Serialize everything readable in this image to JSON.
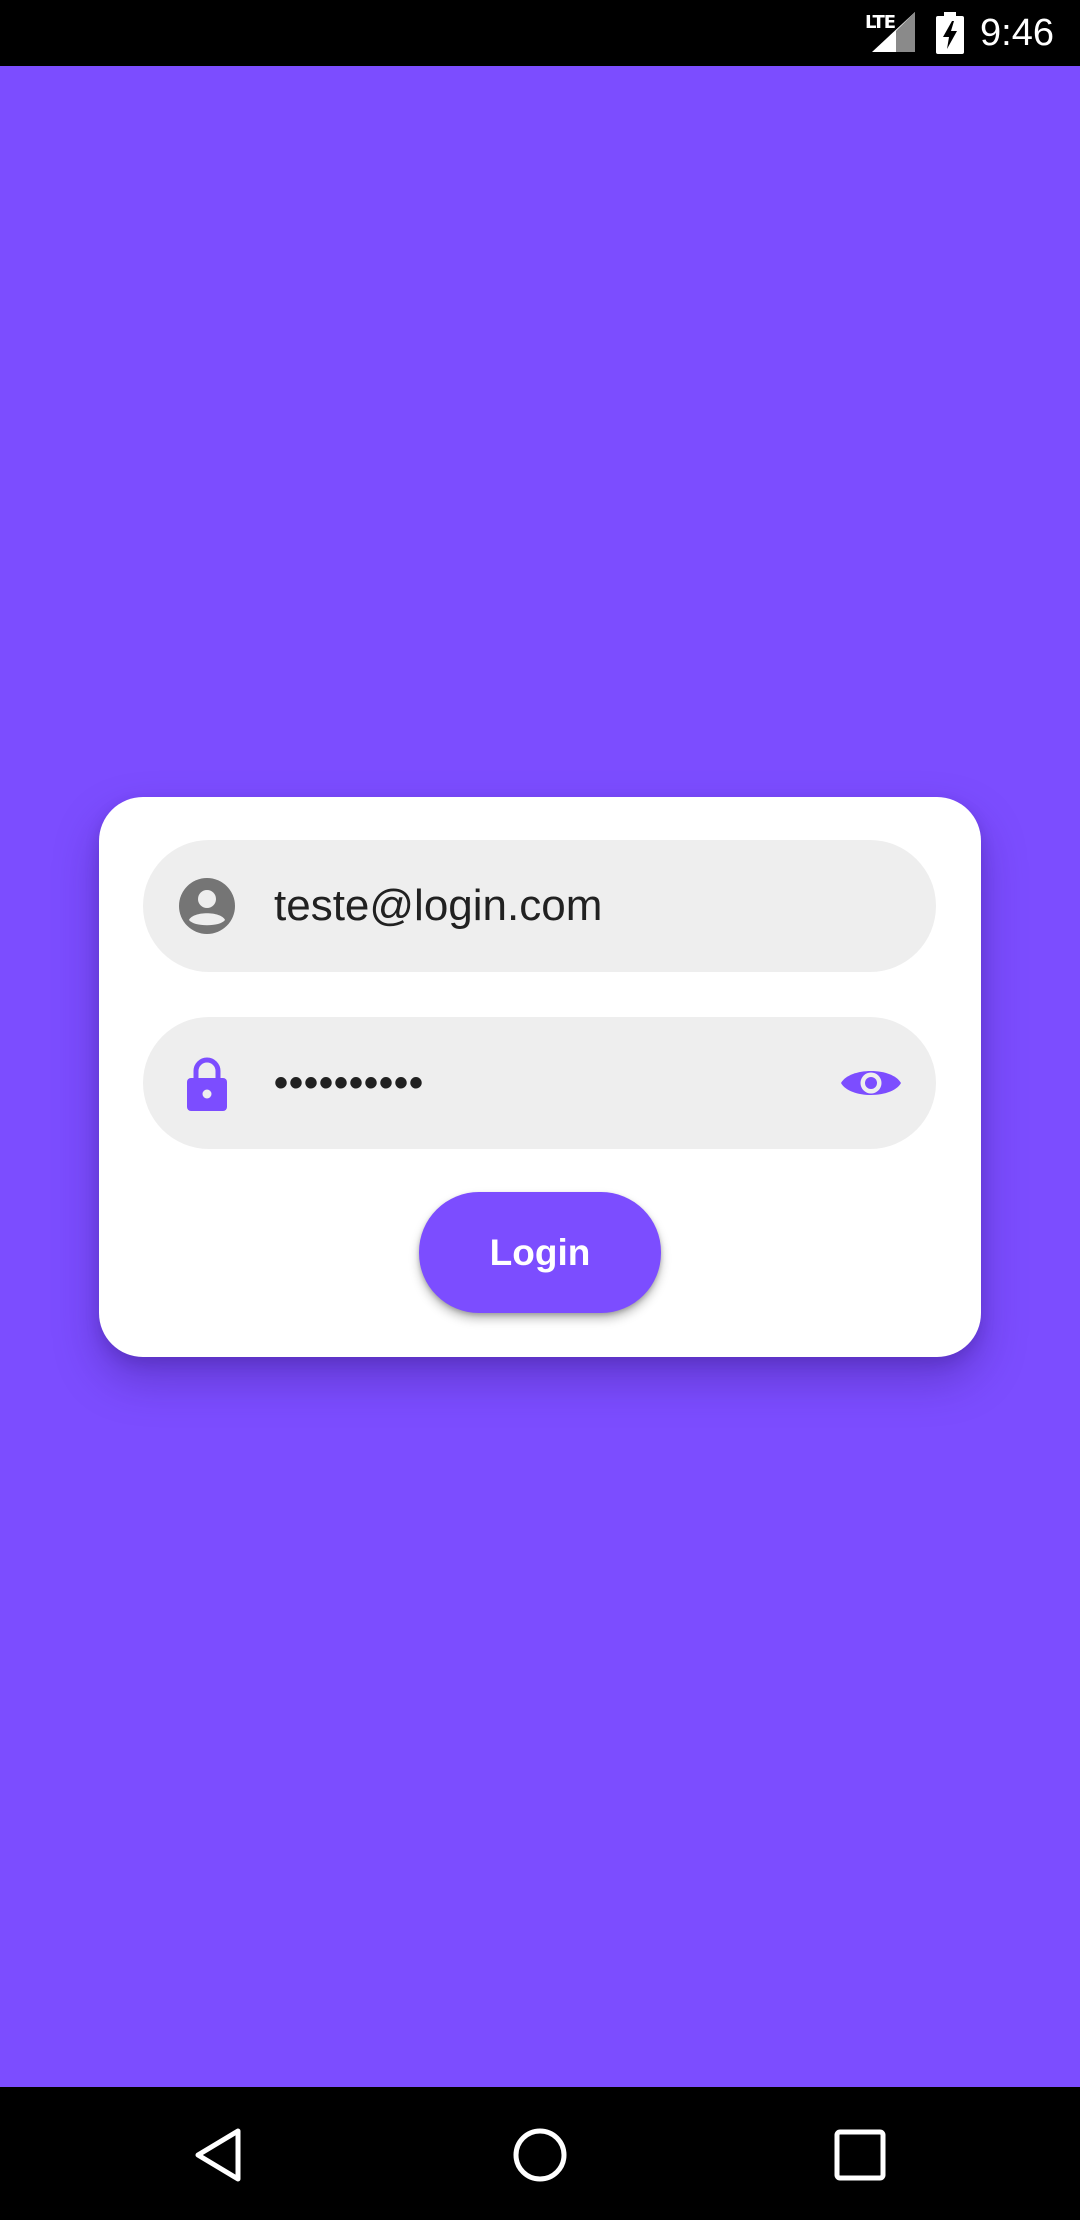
{
  "status_bar": {
    "network_label": "LTE",
    "time": "9:46",
    "signal_icon": "cell-signal-icon",
    "battery_icon": "battery-charging-icon"
  },
  "login_form": {
    "email": {
      "value": "teste@login.com",
      "icon": "account-circle-icon"
    },
    "password": {
      "value": "••••••••••",
      "icon": "lock-icon",
      "toggle_icon": "eye-icon"
    },
    "login_button_label": "Login"
  },
  "nav_bar": {
    "back_icon": "back-triangle-icon",
    "home_icon": "home-circle-icon",
    "recents_icon": "recents-square-icon"
  },
  "colors": {
    "background": "#7c4dff",
    "accent": "#7c4dff",
    "field_background": "#eeeeee",
    "card_background": "#ffffff",
    "system_bars": "#000000"
  }
}
